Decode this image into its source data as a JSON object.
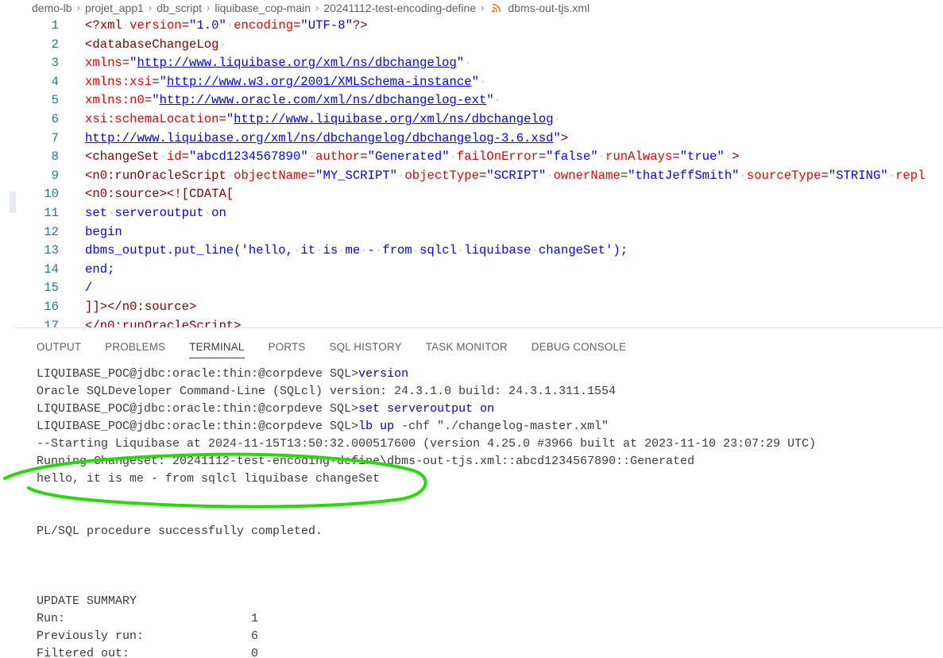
{
  "breadcrumb": {
    "items": [
      "demo-lb",
      "projet_app1",
      "db_script",
      "liquibase_cop-main",
      "20241112-test-encoding-define"
    ],
    "file": "dbms-out-tjs.xml"
  },
  "editor": {
    "line_numbers": [
      "1",
      "2",
      "3",
      "4",
      "5",
      "6",
      "7",
      "8",
      "9",
      "10",
      "11",
      "12",
      "13",
      "14",
      "15",
      "16",
      "17"
    ],
    "lines": [
      [
        [
          "t-tag",
          "<?xml"
        ],
        [
          "dot",
          "·"
        ],
        [
          "t-attr",
          "version"
        ],
        [
          "t-tag",
          "="
        ],
        [
          "t-str",
          "\"1.0\""
        ],
        [
          "dot",
          "·"
        ],
        [
          "t-attr",
          "encoding"
        ],
        [
          "t-tag",
          "="
        ],
        [
          "t-str",
          "\"UTF-8\""
        ],
        [
          "t-tag",
          "?>"
        ]
      ],
      [
        [
          "t-tag",
          "<databaseChangeLog"
        ],
        [
          "dot",
          "·"
        ]
      ],
      [
        [
          "t-attr",
          "xmlns"
        ],
        [
          "t-tag",
          "="
        ],
        [
          "t-str",
          "\""
        ],
        [
          "t-url",
          "http://www.liquibase.org/xml/ns/dbchangelog"
        ],
        [
          "t-str",
          "\""
        ],
        [
          "dot",
          "·"
        ]
      ],
      [
        [
          "t-attr",
          "xmlns:xsi"
        ],
        [
          "t-tag",
          "="
        ],
        [
          "t-str",
          "\""
        ],
        [
          "t-url",
          "http://www.w3.org/2001/XMLSchema-instance"
        ],
        [
          "t-str",
          "\""
        ],
        [
          "dot",
          "·"
        ]
      ],
      [
        [
          "t-attr",
          "xmlns:n0"
        ],
        [
          "t-tag",
          "="
        ],
        [
          "t-str",
          "\""
        ],
        [
          "t-url",
          "http://www.oracle.com/xml/ns/dbchangelog-ext"
        ],
        [
          "t-str",
          "\""
        ],
        [
          "dot",
          "·"
        ]
      ],
      [
        [
          "t-attr",
          "xsi:schemaLocation"
        ],
        [
          "t-tag",
          "="
        ],
        [
          "t-str",
          "\""
        ],
        [
          "t-url",
          "http://www.liquibase.org/xml/ns/dbchangelog"
        ],
        [
          "dot",
          "·"
        ]
      ],
      [
        [
          "t-url",
          "http://www.liquibase.org/xml/ns/dbchangelog/dbchangelog-3.6.xsd"
        ],
        [
          "t-str",
          "\""
        ],
        [
          "t-tag",
          ">"
        ]
      ],
      [
        [
          "t-tag",
          "<changeSet"
        ],
        [
          "dot",
          "·"
        ],
        [
          "t-attr",
          "id"
        ],
        [
          "t-tag",
          "="
        ],
        [
          "t-str",
          "\"abcd1234567890\""
        ],
        [
          "dot",
          "·"
        ],
        [
          "t-attr",
          "author"
        ],
        [
          "t-tag",
          "="
        ],
        [
          "t-str",
          "\"Generated\""
        ],
        [
          "dot",
          "·"
        ],
        [
          "t-attr",
          "failOnError"
        ],
        [
          "t-tag",
          "="
        ],
        [
          "t-str",
          "\"false\""
        ],
        [
          "dot",
          "·"
        ],
        [
          "t-attr",
          "runAlways"
        ],
        [
          "t-tag",
          "="
        ],
        [
          "t-str",
          "\"true\""
        ],
        [
          "dot",
          "·"
        ],
        [
          "t-tag",
          ">"
        ]
      ],
      [
        [
          "t-tag",
          "<n0:runOracleScript"
        ],
        [
          "dot",
          "·"
        ],
        [
          "t-attr",
          "objectName"
        ],
        [
          "t-tag",
          "="
        ],
        [
          "t-str",
          "\"MY_SCRIPT\""
        ],
        [
          "dot",
          "·"
        ],
        [
          "t-attr",
          "objectType"
        ],
        [
          "t-tag",
          "="
        ],
        [
          "t-str",
          "\"SCRIPT\""
        ],
        [
          "dot",
          "·"
        ],
        [
          "t-attr",
          "ownerName"
        ],
        [
          "t-tag",
          "="
        ],
        [
          "t-str",
          "\"thatJeffSmith\""
        ],
        [
          "dot",
          "·"
        ],
        [
          "t-attr",
          "sourceType"
        ],
        [
          "t-tag",
          "="
        ],
        [
          "t-str",
          "\"STRING\""
        ],
        [
          "dot",
          "·"
        ],
        [
          "t-attr",
          "repl"
        ]
      ],
      [
        [
          "t-tag",
          "<n0:source><![CDATA["
        ]
      ],
      [
        [
          "t-txt",
          "set"
        ],
        [
          "dot",
          "·"
        ],
        [
          "t-txt",
          "serveroutput"
        ],
        [
          "dot",
          "·"
        ],
        [
          "t-txt",
          "on"
        ]
      ],
      [
        [
          "t-txt",
          "begin"
        ]
      ],
      [
        [
          "t-txt",
          "dbms_output.put_line('hello,"
        ],
        [
          "dot",
          "·"
        ],
        [
          "t-txt",
          "it"
        ],
        [
          "dot",
          "·"
        ],
        [
          "t-txt",
          "is"
        ],
        [
          "dot",
          "·"
        ],
        [
          "t-txt",
          "me"
        ],
        [
          "dot",
          "·"
        ],
        [
          "t-txt",
          "-"
        ],
        [
          "dot",
          "·"
        ],
        [
          "t-txt",
          "from"
        ],
        [
          "dot",
          "·"
        ],
        [
          "t-txt",
          "sqlcl"
        ],
        [
          "dot",
          "·"
        ],
        [
          "t-txt",
          "liquibase"
        ],
        [
          "dot",
          "·"
        ],
        [
          "t-txt",
          "changeSet');"
        ]
      ],
      [
        [
          "t-txt",
          "end;"
        ]
      ],
      [
        [
          "t-txt",
          "/"
        ]
      ],
      [
        [
          "t-tag",
          "]]></n0:source>"
        ]
      ],
      [
        [
          "t-tag",
          "</n0:runOracleScript>"
        ]
      ]
    ]
  },
  "panel": {
    "tabs": [
      "OUTPUT",
      "PROBLEMS",
      "TERMINAL",
      "PORTS",
      "SQL HISTORY",
      "TASK MONITOR",
      "DEBUG CONSOLE"
    ],
    "active_tab": "TERMINAL"
  },
  "terminal": {
    "prompt": "LIQUIBASE_POC@jdbc:oracle:thin:@corpdeve SQL>",
    "cmd1": "version",
    "out1": "Oracle SQLDeveloper Command-Line (SQLcl) version: 24.3.1.0 build: 24.3.1.311.1554",
    "cmd2": "set serveroutput on",
    "cmd3a": "lb up",
    "cmd3b": " -chf \"./changelog-master.xml\"",
    "out2": "--Starting Liquibase at 2024-11-15T13:50:32.000517600 (version 4.25.0 #3966 built at 2023-11-10 23:07:29 UTC)",
    "out3": "Running Changeset: 20241112-test-encoding-define\\dbms-out-tjs.xml::abcd1234567890::Generated",
    "out4": "hello, it is me - from sqlcl liquibase changeSet",
    "out5": "PL/SQL procedure successfully completed.",
    "summary_title": "UPDATE SUMMARY",
    "summary": [
      {
        "label": "Run:",
        "value": "1"
      },
      {
        "label": "Previously run:",
        "value": "6"
      },
      {
        "label": "Filtered out:",
        "value": "0"
      }
    ]
  },
  "colors": {
    "annotation": "#22dd00",
    "accent": "#3b3b3b"
  }
}
